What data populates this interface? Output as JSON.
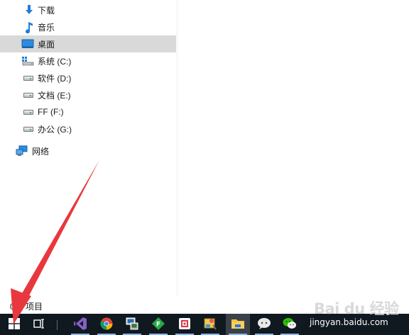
{
  "nav_pane": {
    "items": [
      {
        "label": "下载",
        "icon": "download-arrow-icon"
      },
      {
        "label": "音乐",
        "icon": "music-note-icon"
      },
      {
        "label": "桌面",
        "icon": "desktop-icon",
        "selected": true
      },
      {
        "label": "系统 (C:)",
        "icon": "system-drive-icon"
      },
      {
        "label": "软件 (D:)",
        "icon": "drive-icon"
      },
      {
        "label": "文档 (E:)",
        "icon": "drive-icon"
      },
      {
        "label": "FF (F:)",
        "icon": "drive-icon"
      },
      {
        "label": "办公 (G:)",
        "icon": "drive-icon"
      },
      {
        "label": "网络",
        "icon": "network-icon"
      }
    ]
  },
  "status_bar": {
    "item_count": "0 个项目"
  },
  "taskbar": {
    "buttons": [
      {
        "name": "start",
        "icon": "windows-logo-icon"
      },
      {
        "name": "task-view",
        "icon": "task-view-icon"
      },
      {
        "name": "visual-studio",
        "icon": "visual-studio-icon"
      },
      {
        "name": "chrome",
        "icon": "chrome-icon"
      },
      {
        "name": "remote-app",
        "icon": "remote-desktop-icon"
      },
      {
        "name": "f-app",
        "icon": "green-f-icon"
      },
      {
        "name": "red-app",
        "icon": "red-app-icon"
      },
      {
        "name": "paint-app",
        "icon": "paint-icon"
      },
      {
        "name": "file-explorer",
        "icon": "folder-icon"
      },
      {
        "name": "messenger",
        "icon": "chat-bubble-icon"
      },
      {
        "name": "wechat",
        "icon": "wechat-icon"
      }
    ]
  },
  "watermark": {
    "logo": "Bai du 经验",
    "site": "jingyan.baidu.com"
  },
  "colors": {
    "selection": "#d9d9d9",
    "taskbar": "#101820",
    "annotation_arrow": "#e8383d",
    "accent": "#0078d7"
  }
}
